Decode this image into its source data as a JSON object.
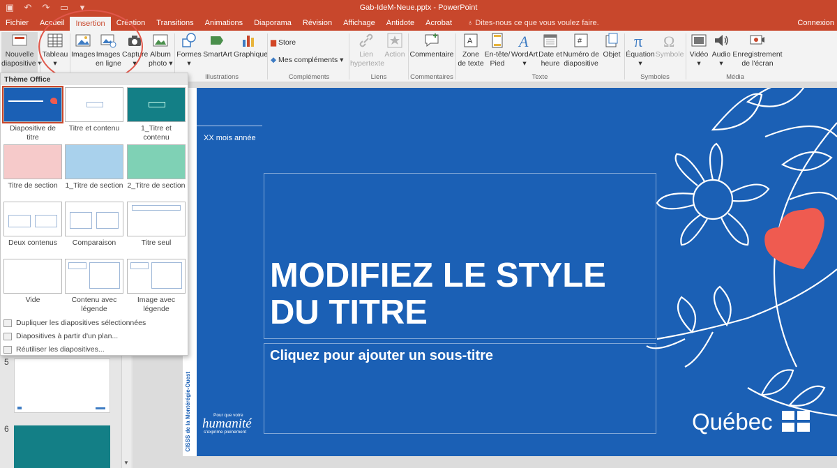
{
  "window": {
    "title": "Gab-IdeM-Neue.pptx - PowerPoint",
    "connect": "Connexion"
  },
  "qat": {
    "save_icon": "save-icon",
    "undo_icon": "undo-icon",
    "redo_icon": "redo-icon",
    "present_icon": "present-icon",
    "customize_icon": "chevron-down-icon"
  },
  "menu": {
    "file": "Fichier",
    "home": "Accueil",
    "insert": "Insertion",
    "design": "Création",
    "transitions": "Transitions",
    "animations": "Animations",
    "slideshow": "Diaporama",
    "review": "Révision",
    "view": "Affichage",
    "antidote": "Antidote",
    "acrobat": "Acrobat",
    "tellme": "Dites-nous ce que vous voulez faire."
  },
  "ribbon": {
    "new_slide": "Nouvelle",
    "new_slide_2": "diapositive",
    "table": "Tableau",
    "images": "Images",
    "online_images": "Images",
    "online_images_2": "en ligne",
    "screenshot": "Capture",
    "album": "Album",
    "album_2": "photo",
    "shapes": "Formes",
    "smartart": "SmartArt",
    "chart": "Graphique",
    "store": "Store",
    "addins": "Mes compléments",
    "link": "Lien",
    "link_2": "hypertexte",
    "action": "Action",
    "comment": "Commentaire",
    "textbox": "Zone",
    "textbox_2": "de texte",
    "header": "En-tête/",
    "header_2": "Pied",
    "wordart": "WordArt",
    "datetime": "Date et",
    "datetime_2": "heure",
    "slidenum": "Numéro de",
    "slidenum_2": "diapositive",
    "object": "Objet",
    "equation": "Équation",
    "symbol": "Symbole",
    "video": "Vidéo",
    "audio": "Audio",
    "screenrec": "Enregistrement",
    "screenrec_2": "de l'écran",
    "groups": {
      "illustrations": "Illustrations",
      "addins": "Compléments",
      "links": "Liens",
      "comments": "Commentaires",
      "text": "Texte",
      "symbols": "Symboles",
      "media": "Média"
    }
  },
  "gallery": {
    "title": "Thème Office",
    "layouts": [
      {
        "label": "Diapositive de",
        "label2": "titre"
      },
      {
        "label": "Titre et contenu",
        "label2": ""
      },
      {
        "label": "1_Titre et contenu",
        "label2": ""
      },
      {
        "label": "Titre de section",
        "label2": ""
      },
      {
        "label": "1_Titre de section",
        "label2": ""
      },
      {
        "label": "2_Titre de section",
        "label2": ""
      },
      {
        "label": "Deux contenus",
        "label2": ""
      },
      {
        "label": "Comparaison",
        "label2": ""
      },
      {
        "label": "Titre seul",
        "label2": ""
      },
      {
        "label": "Vide",
        "label2": ""
      },
      {
        "label": "Contenu avec",
        "label2": "légende"
      },
      {
        "label": "Image avec",
        "label2": "légende"
      }
    ],
    "commands": [
      "Dupliquer les diapositives sélectionnées",
      "Diapositives à partir d'un plan...",
      "Réutiliser les diapositives..."
    ]
  },
  "slides": {
    "num5": "5",
    "num6": "6"
  },
  "slide": {
    "date": "XX mois année",
    "title_line1": "MODIFIEZ LE STYLE",
    "title_line2": "DU TITRE",
    "subtitle": "Cliquez pour ajouter un sous-titre",
    "vertical_text": "CISSS de la Montérégie-Ouest",
    "tag_small": "Pour que votre",
    "tag_big": "humanité",
    "tag_small2": "s'exprime pleinement",
    "logo": "Québec"
  },
  "colors": {
    "accent": "#c8472c",
    "slide_bg": "#1b60b5",
    "heart": "#ef5b50",
    "teal": "#137f86"
  }
}
